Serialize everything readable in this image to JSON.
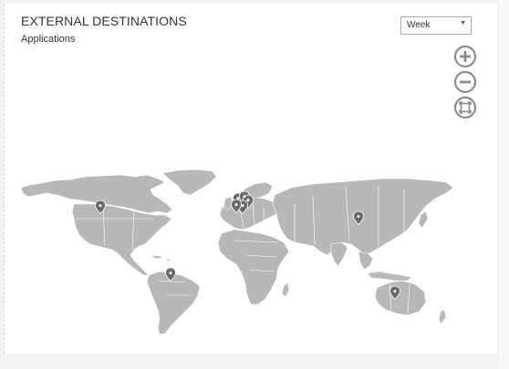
{
  "widget": {
    "title": "EXTERNAL DESTINATIONS",
    "subtitle": "Applications"
  },
  "period_select": {
    "value": "Week"
  },
  "map_controls": [
    {
      "name": "zoom-in-icon",
      "glyph": "plus"
    },
    {
      "name": "zoom-out-icon",
      "glyph": "minus"
    },
    {
      "name": "fit-to-screen-icon",
      "glyph": "expand"
    }
  ],
  "map": {
    "land_color": "#b8b8b8",
    "border_color": "#ffffff",
    "marker_color": "#6e6e6e",
    "markers": [
      {
        "region": "Western United States"
      },
      {
        "region": "United Kingdom"
      },
      {
        "region": "Western Europe"
      },
      {
        "region": "Central Europe"
      },
      {
        "region": "Northern Europe"
      },
      {
        "region": "Spain"
      },
      {
        "region": "China"
      },
      {
        "region": "Brazil"
      },
      {
        "region": "Australia"
      }
    ]
  }
}
